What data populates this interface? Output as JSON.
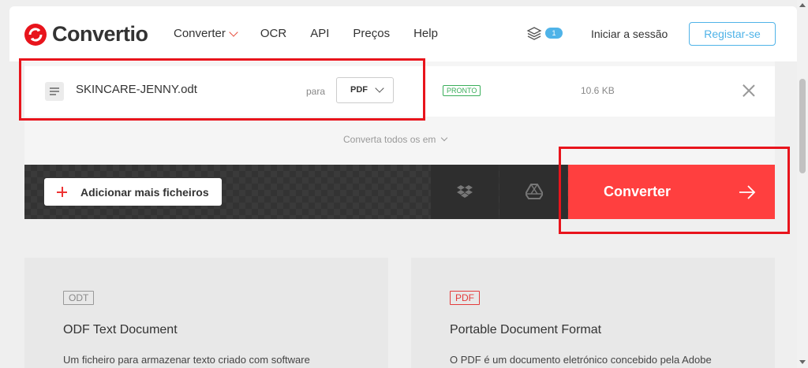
{
  "header": {
    "brand": "Convertio",
    "nav": [
      {
        "label": "Converter"
      },
      {
        "label": "OCR"
      },
      {
        "label": "API"
      },
      {
        "label": "Preços"
      },
      {
        "label": "Help"
      }
    ],
    "layers_badge": "1",
    "login_label": "Iniciar a sessão",
    "signup_label": "Registar-se"
  },
  "file": {
    "name": "SKINCARE-JENNY.odt",
    "to_label": "para",
    "target_format": "PDF",
    "status": "PRONTO",
    "size": "10.6 KB"
  },
  "convert_all_label": "Converta todos os em",
  "actions": {
    "add_label": "Adicionar mais ficheiros",
    "convert_label": "Converter"
  },
  "formats": [
    {
      "badge": "ODT",
      "title": "ODF Text Document",
      "desc": "Um ficheiro para armazenar texto criado com software",
      "color": "#888888"
    },
    {
      "badge": "PDF",
      "title": "Portable Document Format",
      "desc": "O PDF é um documento eletrónico concebido pela Adobe",
      "color": "#e33b3b"
    }
  ],
  "colors": {
    "accent_red": "#ff3f3f",
    "highlight": "#e8141c",
    "link_blue": "#4fb3e8"
  }
}
